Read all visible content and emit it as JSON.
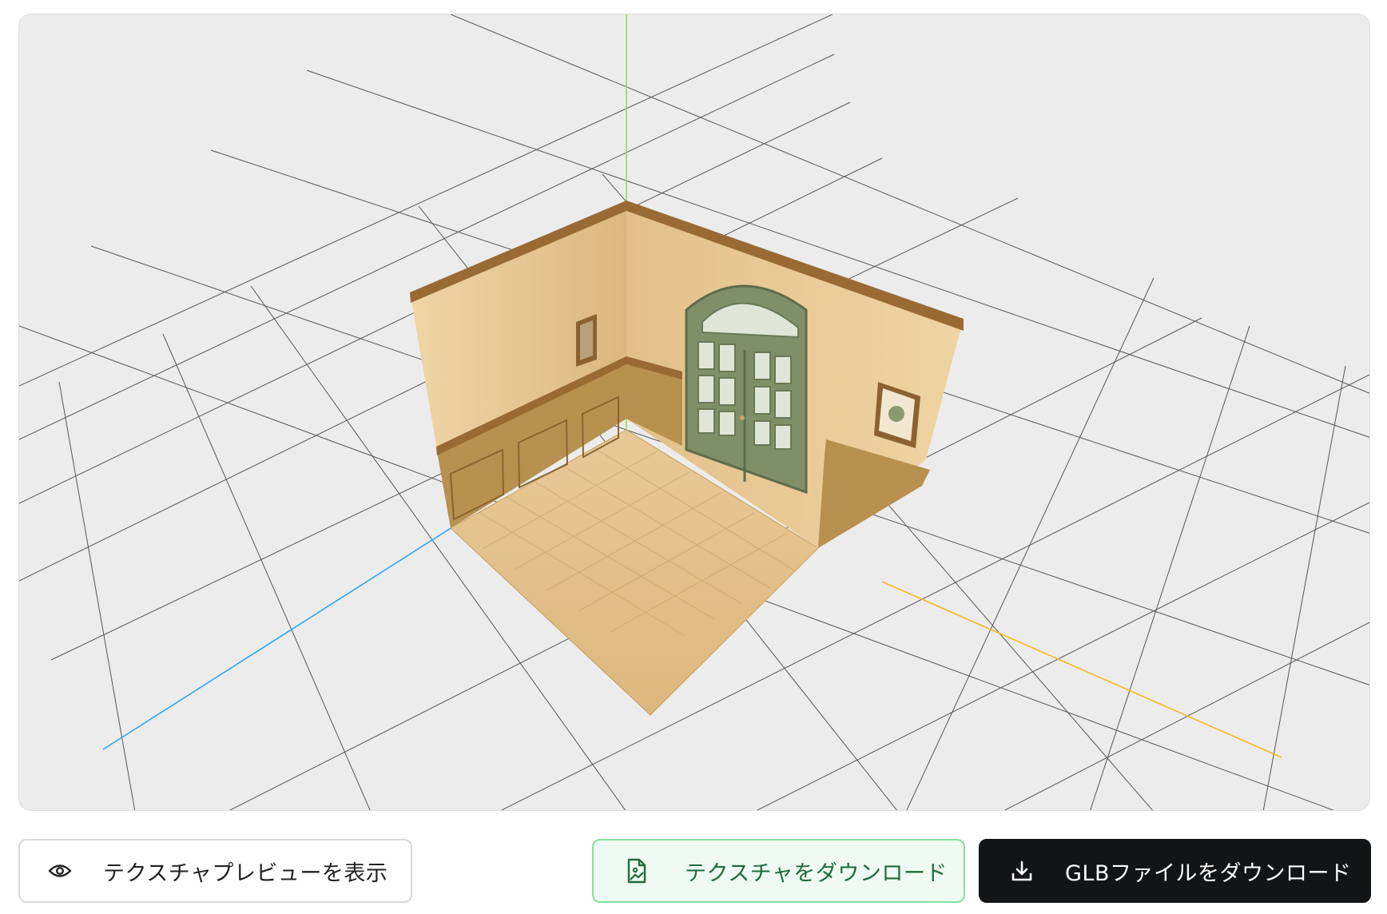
{
  "viewer": {
    "background": "#ececec",
    "axis_colors": {
      "x": "#f5b821",
      "y": "#8fe04e",
      "z": "#2ea6f0"
    },
    "grid_color": "#3a3a3a",
    "model": {
      "wall_color": "#e6c48f",
      "wainscot_color": "#b58a52",
      "trim_color": "#9a6a34",
      "floor_color": "#e3c088",
      "door_color": "#7f8f68"
    }
  },
  "actions": {
    "preview": {
      "label": "テクスチャプレビューを表示",
      "icon": "eye-icon"
    },
    "texture_download": {
      "label": "テクスチャをダウンロード",
      "icon": "image-file-icon"
    },
    "glb_download": {
      "label": "GLBファイルをダウンロード",
      "icon": "download-icon"
    }
  }
}
